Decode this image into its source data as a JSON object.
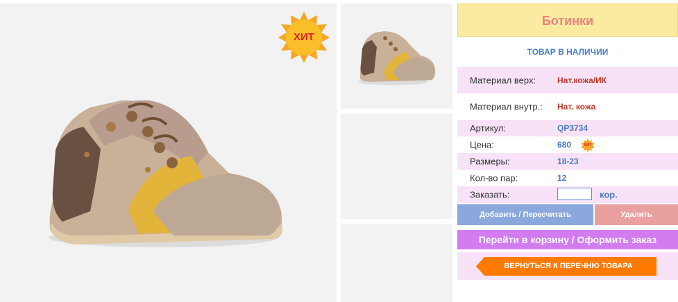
{
  "product": {
    "title": "Ботинки",
    "badge": "ХИТ",
    "stock_status": "ТОВАР В НАЛИЧИИ"
  },
  "specs": {
    "material_top_label": "Материал верх:",
    "material_top_value": "Нат.кожа/ИК",
    "material_inner_label": "Материал внутр.:",
    "material_inner_value": "Нат. кожа",
    "article_label": "Артикул:",
    "article_value": "QP3734",
    "price_label": "Цена:",
    "price_value": "680",
    "price_badge": "ХИТ",
    "sizes_label": "Размеры:",
    "sizes_value": "18-23",
    "pairs_label": "Кол-во пар:",
    "pairs_value": "12",
    "order_label": "Заказать:",
    "order_value": "",
    "order_unit": "кор."
  },
  "actions": {
    "add_label": "Добавить / Пересчитать",
    "delete_label": "Удалить",
    "cart_label": "Перейти в корзину / Оформить заказ",
    "back_label": "ВЕРНУТЬСЯ К ПЕРЕЧНЮ ТОВАРА"
  },
  "colors": {
    "title_bg": "#fbeba0",
    "title_text": "#e8837f",
    "accent_blue": "#4a7dc4",
    "row_alt": "#f7e2f7",
    "add_button": "#8aa8dc",
    "delete_button": "#eba0a0",
    "cart_button": "#d27cf0",
    "back_button": "#ff7a00"
  }
}
